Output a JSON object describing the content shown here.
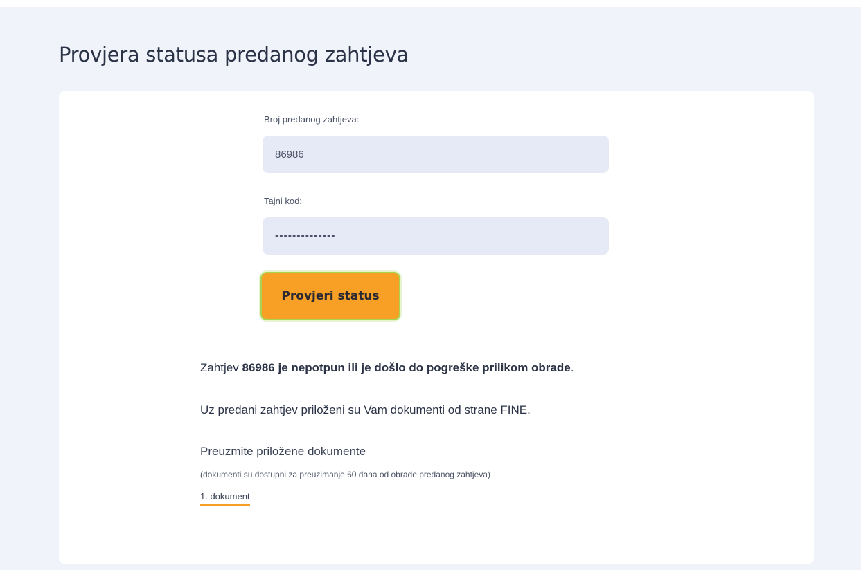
{
  "page": {
    "title": "Provjera statusa predanog zahtjeva"
  },
  "form": {
    "request_number_label": "Broj predanog zahtjeva:",
    "request_number_value": "86986",
    "secret_code_label": "Tajni kod:",
    "secret_code_value": "••••••••••••••",
    "submit_label": "Provjeri status"
  },
  "result": {
    "status_prefix": "Zahtjev ",
    "request_number": "86986",
    "status_suffix": " je nepotpun ili je došlo do pogreške prilikom obrade",
    "status_end": ".",
    "documents_note": "Uz predani zahtjev priloženi su Vam dokumenti od strane FINE.",
    "download_heading": "Preuzmite priložene dokumente",
    "availability_note": "(dokumenti su dostupni za preuzimanje 60 dana od obrade predanog zahtjeva)",
    "documents": [
      {
        "label": "1. dokument"
      }
    ]
  },
  "colors": {
    "background": "#f0f3fa",
    "accent": "#f8a025",
    "focus_ring": "#a9d352",
    "input_background": "#e6eaf6"
  }
}
